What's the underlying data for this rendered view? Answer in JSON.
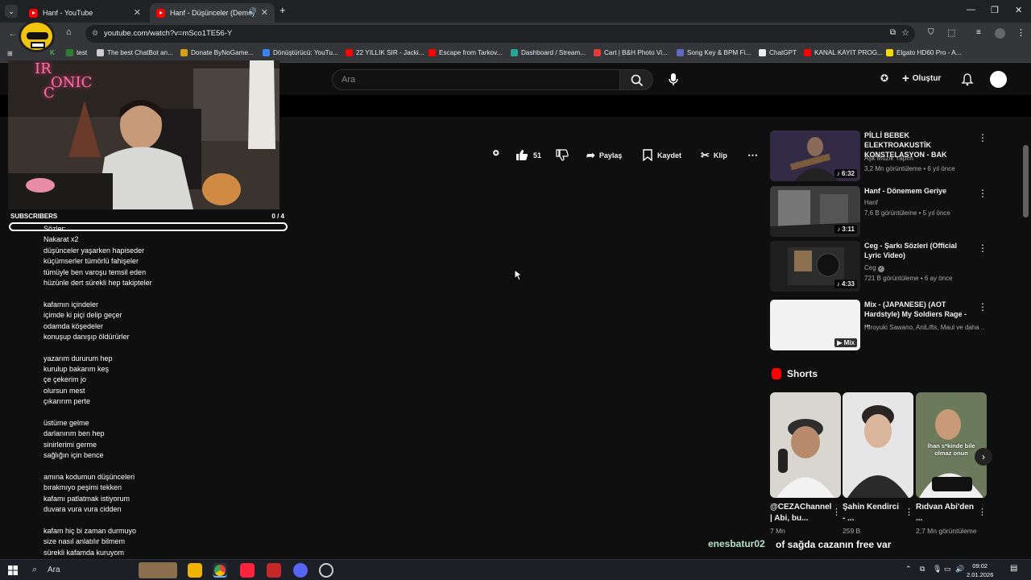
{
  "browser": {
    "tabs": [
      {
        "title": "Hanf - YouTube"
      },
      {
        "title": "Hanf - Düşünceler (Demo)"
      }
    ],
    "url": "youtube.com/watch?v=mSco1TE56-Y",
    "bookmarks": [
      "test",
      "The best ChatBot an...",
      "Donate ByNoGame...",
      "Dönüştürücü: YouTu...",
      "22 YILLIK SIR - Jacki...",
      "Escape from Tarkov...",
      "Dashboard / Stream...",
      "Cart | B&H Photo Vi...",
      "Song Key & BPM Fi...",
      "ChatGPT",
      "KANAL KAYIT PROG...",
      "Elgato HD60 Pro - A..."
    ]
  },
  "header": {
    "search_placeholder": "Ara",
    "create_label": "Oluştur"
  },
  "stream_overlay": {
    "logo_top": "IR",
    "logo_right": "ONIC",
    "logo_bottom": "C",
    "subscribers_label": "SUBSCRIBERS",
    "subscribers_count": "0 / 4",
    "subscribers_progress": 0.0,
    "chat_user": "enesbatur02",
    "chat_message": "of sağda cazanın free var"
  },
  "lyrics": [
    "Sözler:",
    "Nakarat x2",
    "düşünceler yaşarken hapiseder",
    "küçümserler tümörlü fahişeler",
    "tümüyle ben varoşu temsil eden",
    "hüzünle dert sürekli hep takipteler",
    "",
    "kafamın içindeler",
    "içimde ki piçi delip geçer",
    "odamda köşedeler",
    "konuşup danışıp öldürürler",
    "",
    "yazarım dururum hep",
    "kurulup bakarım keş",
    "çe çekerim jo",
    "olursun mest",
    "çıkarırım perte",
    "",
    "üstüme gelme",
    "darlanırım ben hep",
    "sinirlerimi germe",
    "sağlığın için bence",
    "",
    "amına kodumun düşünceleri",
    "bırakmıyo peşimi tekken",
    "kafamı patlatmak istiyorum",
    "duvara vura vura cidden",
    "",
    "kafam hiç bi zaman durmuyo",
    "size nasıl anlatılır bilmem",
    "sürekli kafamda kuruyom"
  ],
  "actions": {
    "like_count": "51",
    "share_label": "Paylaş",
    "save_label": "Kaydet",
    "clip_label": "Klip"
  },
  "recommendations": [
    {
      "title": "PİLLİ BEBEK ELEKTROAKUSTİK KONSTELASYON - BAK",
      "channel": "Aşk Müzik Yapım",
      "meta": "3,2 Mn görüntüleme • 6 yıl önce",
      "duration": "6:32"
    },
    {
      "title": "Hanf - Dönemem Geriye",
      "channel": "Hanf",
      "meta": "7,6 B görüntüleme • 5 yıl önce",
      "duration": "3:11"
    },
    {
      "title": "Ceg - Şarkı Sözleri (Official Lyric Video)",
      "channel": "Ceg",
      "meta": "721 B görüntüleme • 6 ay önce",
      "duration": "4:33"
    },
    {
      "title": "Mix - (JAPANESE) (AOT Hardstyle) My Soldiers Rage - ...",
      "channel": "Hiroyuki Sawano, AniLifts, Maul ve daha ...",
      "meta": "",
      "duration": "Mix"
    }
  ],
  "shorts": {
    "heading": "Shorts",
    "items": [
      {
        "title": "@CEZAChannel | Abi, bu...",
        "views": "7 Mn"
      },
      {
        "title": "Şahin Kendirci - ...",
        "views": "259 B"
      },
      {
        "title": "Rıdvan Abi'den ...",
        "views": "2,7 Mn görüntüleme"
      }
    ],
    "thumb_caption": "İhan s*kinde bile olmaz onun"
  },
  "taskbar": {
    "search_label": "Ara",
    "time": "09:02",
    "date": "2.01.2026"
  },
  "colors": {
    "accent": "#ff0000",
    "chat_user": "#b6e0c8",
    "logo_pink": "#ff6fa8"
  }
}
